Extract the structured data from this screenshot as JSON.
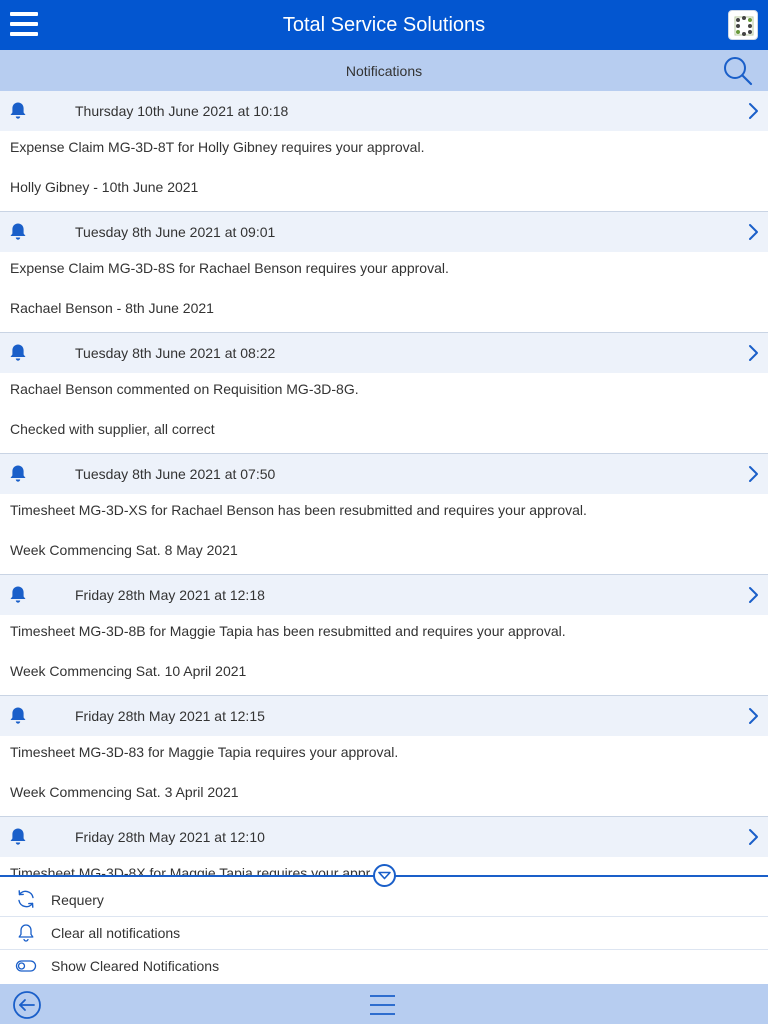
{
  "header": {
    "title": "Total Service Solutions",
    "menu_icon": "hamburger-icon",
    "app_icon": "app-logo-icon"
  },
  "subheader": {
    "title": "Notifications",
    "search_icon": "search-icon"
  },
  "colors": {
    "primary": "#0356d0",
    "subbar": "#b7cdf0",
    "row_header": "#edf2fa",
    "icon": "#1a5fc9"
  },
  "notifications": [
    {
      "date": "Thursday 10th June 2021 at 10:18",
      "message": "Expense Claim MG-3D-8T for Holly Gibney requires your approval.",
      "detail": "Holly Gibney - 10th June 2021"
    },
    {
      "date": "Tuesday 8th June 2021 at 09:01",
      "message": "Expense Claim MG-3D-8S for Rachael Benson requires your approval.",
      "detail": "Rachael Benson - 8th June 2021"
    },
    {
      "date": "Tuesday 8th June 2021 at 08:22",
      "message": "Rachael Benson commented on Requisition MG-3D-8G.",
      "detail": "Checked with supplier, all correct"
    },
    {
      "date": "Tuesday 8th June 2021 at 07:50",
      "message": "Timesheet MG-3D-XS for Rachael Benson has been resubmitted and requires your approval.",
      "detail": "Week Commencing Sat. 8 May 2021"
    },
    {
      "date": "Friday 28th May 2021 at 12:18",
      "message": "Timesheet MG-3D-8B for Maggie Tapia has been resubmitted and requires your approval.",
      "detail": "Week Commencing Sat. 10 April 2021"
    },
    {
      "date": "Friday 28th May 2021 at 12:15",
      "message": "Timesheet MG-3D-83 for Maggie Tapia requires your approval.",
      "detail": "Week Commencing Sat. 3 April 2021"
    },
    {
      "date": "Friday 28th May 2021 at 12:10",
      "message": "Timesheet MG-3D-8X for Maggie Tapia requires your appr",
      "detail": ""
    }
  ],
  "actions": [
    {
      "label": "Requery",
      "icon": "refresh-icon"
    },
    {
      "label": "Clear all notifications",
      "icon": "bell-outline-icon"
    },
    {
      "label": "Show Cleared Notifications",
      "icon": "toggle-icon"
    }
  ],
  "footer": {
    "back_icon": "back-arrow-icon",
    "menu_icon": "hamburger-icon"
  }
}
